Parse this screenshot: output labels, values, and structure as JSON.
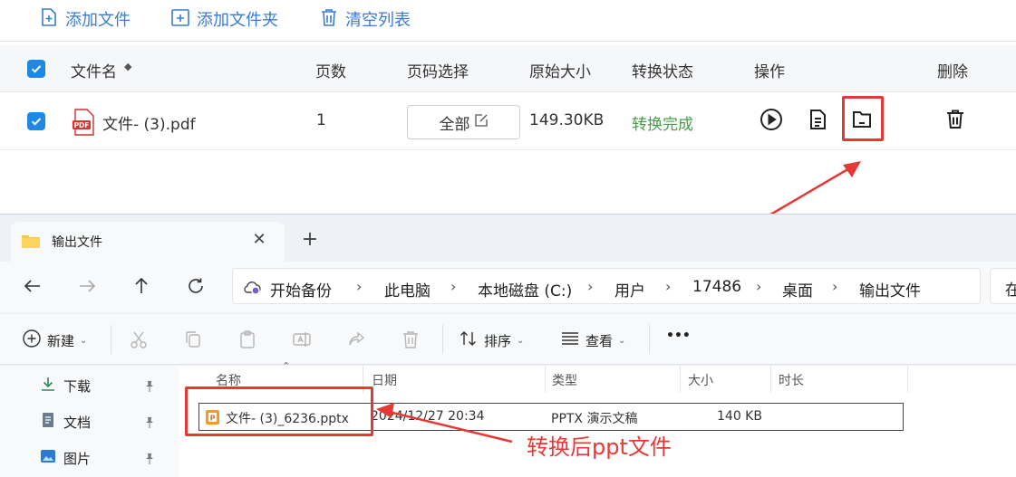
{
  "toolbar": {
    "add_file": "添加文件",
    "add_folder": "添加文件夹",
    "clear_list": "清空列表"
  },
  "table": {
    "headers": {
      "filename": "文件名",
      "pages": "页数",
      "range": "页码选择",
      "size": "原始大小",
      "status": "转换状态",
      "actions": "操作",
      "delete": "删除"
    },
    "sort_indicator": "◆",
    "rows": [
      {
        "checked": true,
        "filename": "文件- (3).pdf",
        "pages": "1",
        "range": "全部",
        "size": "149.30KB",
        "status": "转换完成"
      }
    ],
    "colors": {
      "status_done": "#43a047",
      "accent": "#1e88e5",
      "highlight": "#e53935"
    }
  },
  "explorer": {
    "tab_title": "输出文件",
    "breadcrumbs": [
      "开始备份",
      "此电脑",
      "本地磁盘 (C:)",
      "用户",
      "17486",
      "桌面",
      "输出文件"
    ],
    "search_stub": "在",
    "commands": {
      "new": "新建",
      "sort": "排序",
      "view": "查看",
      "more": "•••"
    },
    "sidebar": [
      {
        "label": "下载",
        "icon": "download-icon"
      },
      {
        "label": "文档",
        "icon": "document-icon"
      },
      {
        "label": "图片",
        "icon": "picture-icon"
      }
    ],
    "columns": {
      "name": "名称",
      "date": "日期",
      "type": "类型",
      "size": "大小",
      "duration": "时长"
    },
    "files": [
      {
        "name": "文件- (3)_6236.pptx",
        "date": "2024/12/27 20:34",
        "type": "PPTX 演示文稿",
        "size": "140 KB"
      }
    ]
  },
  "annotation": {
    "text": "转换后ppt文件"
  }
}
